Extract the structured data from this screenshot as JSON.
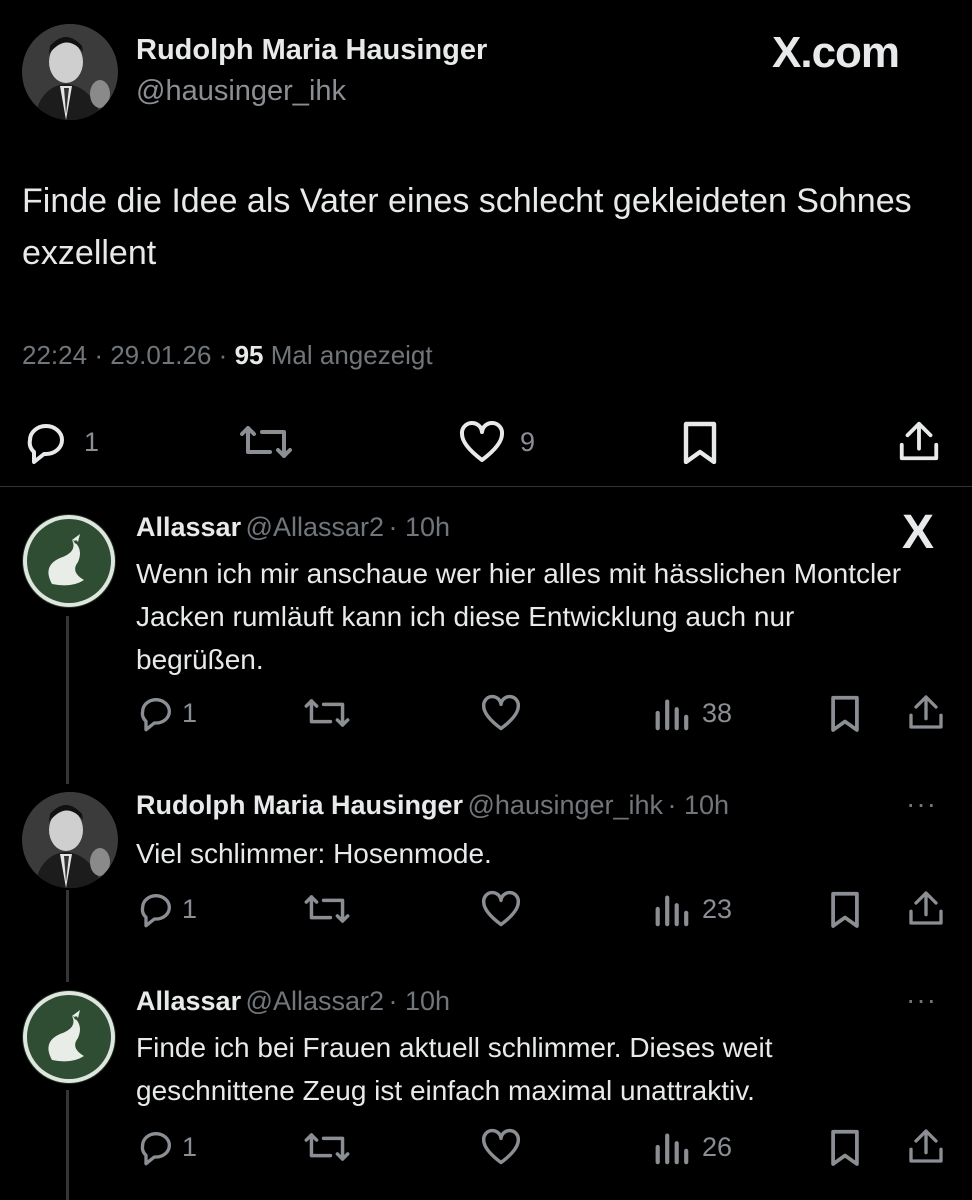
{
  "brand": {
    "logo": "X.com",
    "small_logo": "X"
  },
  "main_tweet": {
    "author_name": "Rudolph Maria Hausinger",
    "author_handle": "@hausinger_ihk",
    "avatar": "man-portrait-avatar",
    "text": "Finde die Idee als Vater eines schlecht gekleideten Sohnes exzellent",
    "time": "22:24",
    "date": "29.01.26",
    "views_count": "95",
    "views_label": "Mal angezeigt",
    "separator": "·",
    "replies": "1",
    "likes": "9"
  },
  "replies": [
    {
      "author_name": "Allassar",
      "author_handle": "@Allassar2",
      "time": "· 10h",
      "avatar": "dragon-emblem-avatar",
      "text": "Wenn ich mir anschaue wer hier alles mit hässlichen Montcler Jacken rumläuft kann ich diese Entwicklung auch nur begrüßen.",
      "replies": "1",
      "views": "38"
    },
    {
      "author_name": "Rudolph Maria Hausinger",
      "author_handle": "@hausinger_ihk",
      "time": "· 10h",
      "avatar": "man-portrait-avatar",
      "text": "Viel schlimmer: Hosenmode.",
      "replies": "1",
      "views": "23"
    },
    {
      "author_name": "Allassar",
      "author_handle": "@Allassar2",
      "time": "· 10h",
      "avatar": "dragon-emblem-avatar",
      "text": "Finde ich bei Frauen aktuell schlimmer. Dieses weit geschnittene Zeug ist einfach maximal unattraktiv.",
      "replies": "1",
      "views": "26"
    }
  ],
  "more_icon": "···",
  "colors": {
    "background": "#000000",
    "text": "#e7e9ea",
    "muted": "#71767b"
  }
}
